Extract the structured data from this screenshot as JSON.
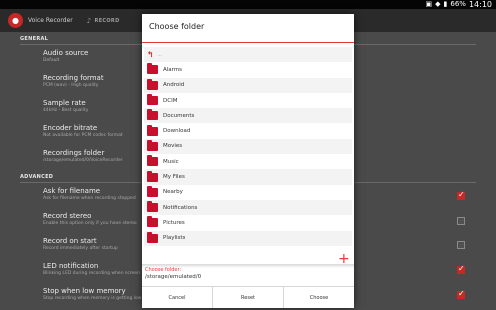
{
  "statusbar": {
    "battery": "66%",
    "time": "14:10"
  },
  "actionbar": {
    "title": "Voice Recorder",
    "record_tab": "RECORD"
  },
  "settings": {
    "section_general": "GENERAL",
    "section_advanced": "ADVANCED",
    "items": [
      {
        "title": "Audio source",
        "summary": "Default"
      },
      {
        "title": "Recording format",
        "summary": "PCM (wav) - High quality"
      },
      {
        "title": "Sample rate",
        "summary": "44kHz - Best quality"
      },
      {
        "title": "Encoder bitrate",
        "summary": "Not available for PCM codec format"
      },
      {
        "title": "Recordings folder",
        "summary": "/storage/emulated/0/VoiceRecorder"
      },
      {
        "title": "Ask for filename",
        "summary": "Ask for filename when recording stopped",
        "checked": true
      },
      {
        "title": "Record stereo",
        "summary": "Enable this option only if you have stereo",
        "checked": false
      },
      {
        "title": "Record on start",
        "summary": "Record immediately after startup",
        "checked": false
      },
      {
        "title": "LED notification",
        "summary": "Blinking LED during recording when screen",
        "checked": true
      },
      {
        "title": "Stop when low memory",
        "summary": "Stop recording when memory is getting low",
        "checked": true
      }
    ]
  },
  "dialog": {
    "title": "Choose folder",
    "up_label": "..",
    "folders": [
      "Alarms",
      "Android",
      "DCIM",
      "Documents",
      "Download",
      "Movies",
      "Music",
      "My Files",
      "Nearby",
      "Notifications",
      "Pictures",
      "Playlists"
    ],
    "choose_label": "Choose folder:",
    "current_path": "/storage/emulated/0",
    "buttons": {
      "cancel": "Cancel",
      "reset": "Reset",
      "choose": "Choose"
    }
  },
  "colors": {
    "accent": "#e53935",
    "folder": "#c8102e",
    "background": "#4a4a4a"
  }
}
